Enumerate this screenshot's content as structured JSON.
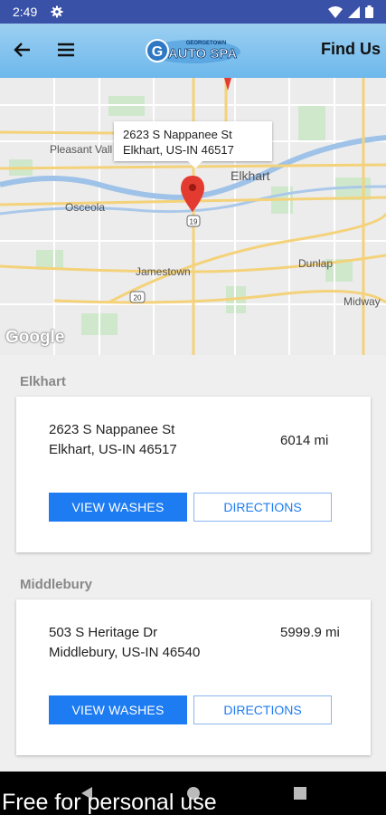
{
  "status": {
    "time": "2:49"
  },
  "header": {
    "title": "Find Us",
    "logo_text": "AUTO SPA",
    "logo_small": "GEORGETOWN"
  },
  "map": {
    "callout_line1": "2623 S Nappanee St",
    "callout_line2": "Elkhart, US-IN  46517",
    "labels": {
      "pleasant_valley": "Pleasant Vall",
      "elkhart": "Elkhart",
      "osceola": "Osceola",
      "jamestown": "Jamestown",
      "dunlap": "Dunlap",
      "midway": "Midway",
      "route19": "19",
      "route20": "20"
    },
    "google": "Google"
  },
  "locations": [
    {
      "section": "Elkhart",
      "address_line1": "2623 S Nappanee St",
      "address_line2": "Elkhart, US-IN  46517",
      "distance": "6014 mi",
      "view_label": "VIEW WASHES",
      "directions_label": "DIRECTIONS"
    },
    {
      "section": "Middlebury",
      "address_line1": "503 S Heritage Dr",
      "address_line2": "Middlebury, US-IN  46540",
      "distance": "5999.9 mi",
      "view_label": "VIEW WASHES",
      "directions_label": "DIRECTIONS"
    }
  ],
  "footer": {
    "watermark": "Free for personal use"
  },
  "colors": {
    "status_bar": "#3a51a8",
    "primary": "#1e7cf2",
    "app_bar": "#6db8ec"
  }
}
